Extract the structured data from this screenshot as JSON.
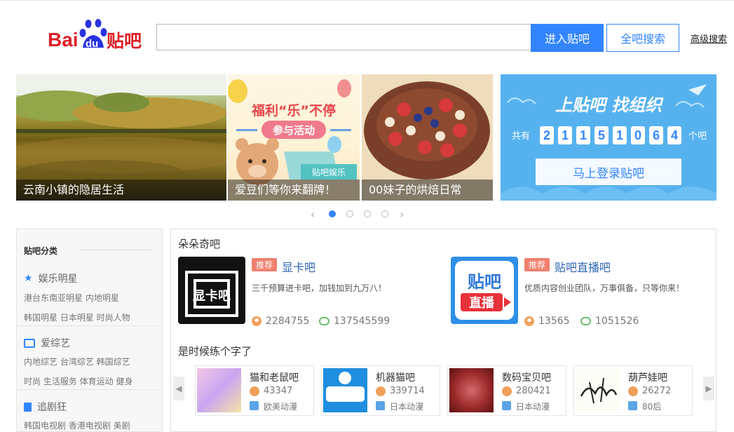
{
  "header": {
    "logo_text_bai": "Bai",
    "logo_text_du": "du",
    "logo_text_tieba": "贴吧",
    "search_value": "",
    "enter_button": "进入贴吧",
    "all_search_button": "全吧搜索",
    "advanced_search": "高级搜索"
  },
  "carousel": {
    "slides": [
      {
        "caption": "云南小镇的隐居生活"
      },
      {
        "caption": "爱豆们等你来翻牌！",
        "title_line1": "福利“乐”不停",
        "title_line2": "参与活动",
        "badge": "贴吧娱乐"
      },
      {
        "caption": "00妹子的烘焙日常"
      }
    ],
    "dots_count": 4,
    "active_dot": 1
  },
  "login_panel": {
    "headline": "上贴吧 找组织",
    "count_prefix": "共有",
    "count_digits": [
      "2",
      "1",
      "1",
      "5",
      "1",
      "0",
      "6",
      "4"
    ],
    "count_suffix": "个吧",
    "login_button": "马上登录贴吧"
  },
  "sidebar": {
    "heading": "贴吧分类",
    "categories": [
      {
        "name": "娱乐明星",
        "icon": "star-icon",
        "subs": [
          "港台东南亚明星 内地明星",
          "韩国明星 日本明星 时尚人物"
        ]
      },
      {
        "name": "爱综艺",
        "icon": "tv-icon",
        "subs": [
          "内地综艺 台湾综艺 韩国综艺",
          "时尚 生活服务 体育运动 健身"
        ]
      },
      {
        "name": "追剧狂",
        "icon": "film-icon",
        "subs": [
          "韩国电视剧 香港电视剧 美剧"
        ]
      }
    ]
  },
  "main": {
    "section1_title": "朵朵奇吧",
    "featured": [
      {
        "tag": "推荐",
        "name": "显卡吧",
        "desc": "三千预算进卡吧，加钱加到九万八！",
        "members": "2284755",
        "posts": "137545599",
        "img_text": "显卡吧"
      },
      {
        "tag": "推荐",
        "name": "贴吧直播吧",
        "desc": "优质内容创业团队，万事俱备，只等你来！",
        "members": "13565",
        "posts": "1051526",
        "img_text_1": "贴吧",
        "img_text_2": "直播"
      }
    ],
    "section2_title": "是时候练个字了",
    "cards": [
      {
        "name": "猫和老鼠吧",
        "members": "43347",
        "tag": "欧美动漫"
      },
      {
        "name": "机器猫吧",
        "members": "339714",
        "tag": "日本动漫"
      },
      {
        "name": "数码宝贝吧",
        "members": "280421",
        "tag": "日本动漫"
      },
      {
        "name": "葫芦娃吧",
        "members": "26272",
        "tag": "80后"
      }
    ]
  }
}
